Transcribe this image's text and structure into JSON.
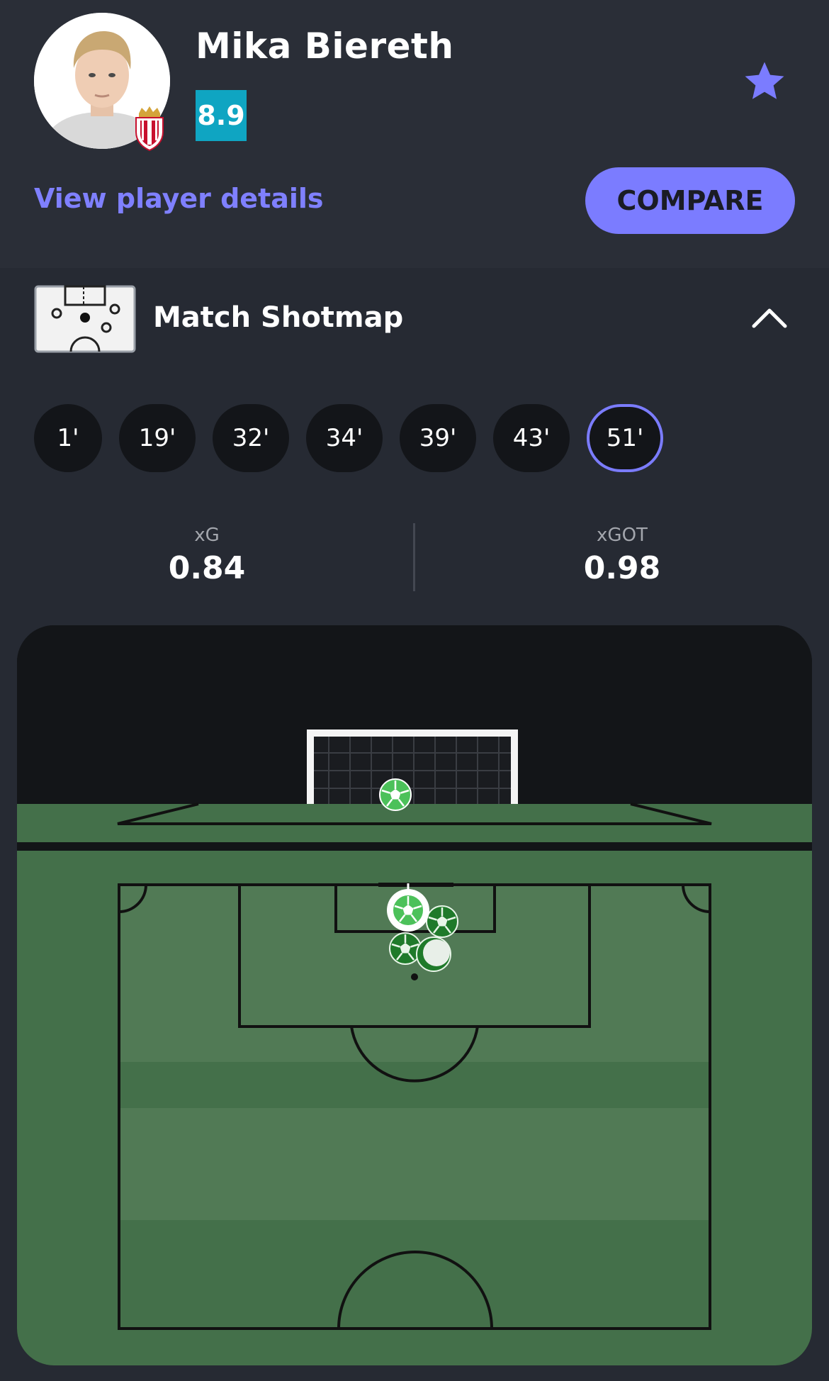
{
  "player": {
    "name": "Mika Biereth",
    "rating": "8.9",
    "details_link": "View player details",
    "compare_label": "COMPARE"
  },
  "shotmap": {
    "title": "Match Shotmap",
    "minutes": [
      "1'",
      "19'",
      "32'",
      "34'",
      "39'",
      "43'",
      "51'"
    ],
    "selected_minute": "51'",
    "stats": {
      "xg_label": "xG",
      "xg_value": "0.84",
      "xgot_label": "xGOT",
      "xgot_value": "0.98"
    }
  },
  "colors": {
    "accent": "#7b7cff",
    "rating_bg": "#0fa5c2",
    "background": "#262a33",
    "pitch_dark": "#44704a",
    "pitch_light": "#517a55"
  },
  "icons": [
    "star-icon",
    "chevron-up-icon",
    "shotmap-icon",
    "club-crest-icon",
    "ball-icon"
  ]
}
